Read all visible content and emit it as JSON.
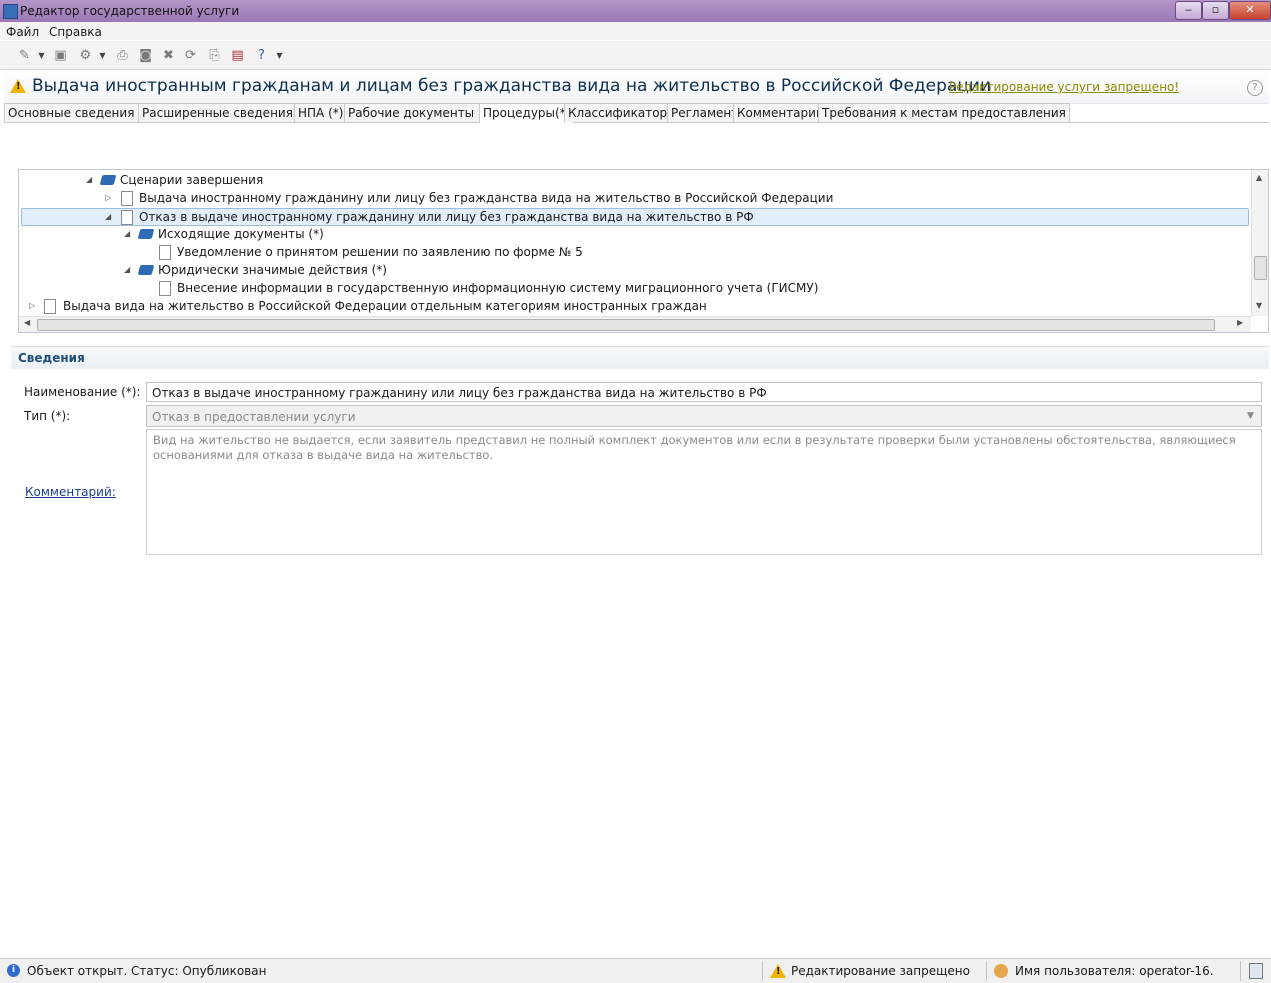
{
  "window": {
    "title": "Редактор государственной услуги",
    "min_label": "‒",
    "max_label": "▫",
    "close_label": "✕"
  },
  "menu": [
    "Файл",
    "Справка"
  ],
  "toolbar": {
    "icons": [
      "new-document-icon",
      "save-icon",
      "settings-icon",
      "print-icon",
      "print-preview-icon",
      "delete-icon",
      "refresh-icon",
      "export-icon",
      "pdf-icon",
      "help-icon"
    ]
  },
  "header": {
    "title": "Выдача иностранным гражданам и лицам без гражданства вида на жительство в Российской Федерации",
    "edit_forbidden": "Редактирование услуги запрещено!",
    "help": "?"
  },
  "tabs": [
    {
      "label": "Основные сведения (*)",
      "active": false
    },
    {
      "label": "Расширенные сведения (*)",
      "active": false
    },
    {
      "label": "НПА (*)",
      "active": false
    },
    {
      "label": "Рабочие документы (*)",
      "active": false
    },
    {
      "label": "Процедуры(*)",
      "active": true
    },
    {
      "label": "Классификаторы",
      "active": false
    },
    {
      "label": "Регламент",
      "active": false
    },
    {
      "label": "Комментарии",
      "active": false
    },
    {
      "label": "Требования к местам предоставления",
      "active": false
    }
  ],
  "tree": {
    "rows": [
      {
        "label": "Сценарии завершения",
        "icon": "book-icon",
        "arrow": "◢",
        "selected": false
      },
      {
        "label": "Выдача иностранному гражданину или лицу без гражданства вида на жительство в Российской Федерации",
        "icon": "document-icon",
        "arrow": "▷",
        "selected": false
      },
      {
        "label": "Отказ в выдаче иностранному гражданину или лицу без гражданства вида на жительство в РФ",
        "icon": "document-icon",
        "arrow": "◢",
        "selected": true
      },
      {
        "label": "Исходящие документы (*)",
        "icon": "book-icon",
        "arrow": "◢",
        "selected": false
      },
      {
        "label": "Уведомление о принятом решении по заявлению по форме № 5",
        "icon": "document-icon",
        "arrow": "",
        "selected": false
      },
      {
        "label": "Юридически значимые действия (*)",
        "icon": "book-icon",
        "arrow": "◢",
        "selected": false
      },
      {
        "label": "Внесение информации в государственную информационную систему миграционного учета (ГИСМУ)",
        "icon": "document-icon",
        "arrow": "",
        "selected": false
      },
      {
        "label": "Выдача вида на жительство в Российской Федерации отдельным категориям иностранных граждан",
        "icon": "document-icon",
        "arrow": "▷",
        "selected": false
      }
    ]
  },
  "details": {
    "section_title": "Сведения",
    "name_label": "Наименование (*):",
    "name_value": "Отказ в выдаче иностранному гражданину или лицу без гражданства вида на жительство в РФ",
    "type_label": "Тип (*):",
    "type_value": "Отказ в предоставлении услуги",
    "comment_text": "Вид на жительство не выдается, если заявитель представил не полный комплект документов или если в результате проверки были установлены обстоятельства, являющиеся основаниями для отказа в выдаче вида на жительство.",
    "comment_label": "Комментарий:"
  },
  "status": {
    "object": "Объект открыт. Статус: Опубликован",
    "editing": "Редактирование запрещено",
    "user": "Имя пользователя: operator-16."
  },
  "colors": {
    "title_bar": "#a987c1",
    "selection": "#e3eefb",
    "header_title": "#0f2f4f",
    "warning_link": "#8a8a00",
    "section_title": "#1e4e7a"
  }
}
